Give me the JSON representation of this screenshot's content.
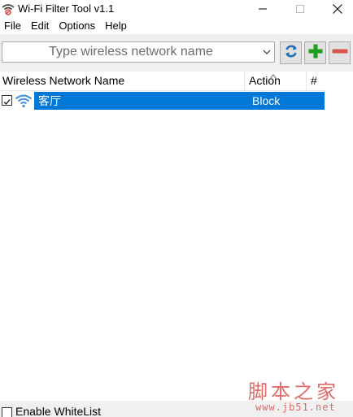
{
  "window": {
    "title": "Wi-Fi Filter Tool v1.1"
  },
  "menu": {
    "items": [
      "File",
      "Edit",
      "Options",
      "Help"
    ]
  },
  "toolbar": {
    "network_input_placeholder": "Type wireless network name",
    "refresh_icon": "refresh-icon",
    "add_icon": "plus-icon",
    "remove_icon": "minus-icon"
  },
  "list": {
    "columns": [
      "Wireless Network Name",
      "Action",
      "#"
    ],
    "rows": [
      {
        "checked": true,
        "name": "客厅",
        "action": "Block",
        "icon": "wifi-icon"
      }
    ]
  },
  "footer": {
    "enable_whitelist_label": "Enable WhiteList",
    "enable_whitelist_checked": false
  },
  "watermark": {
    "text": "脚本之家",
    "url": "www.jb51.net"
  },
  "colors": {
    "selection": "#0078d7",
    "add": "#1e9e1e",
    "remove": "#d9534f",
    "refresh": "#1e6fb8",
    "watermark": "#d9534f"
  }
}
